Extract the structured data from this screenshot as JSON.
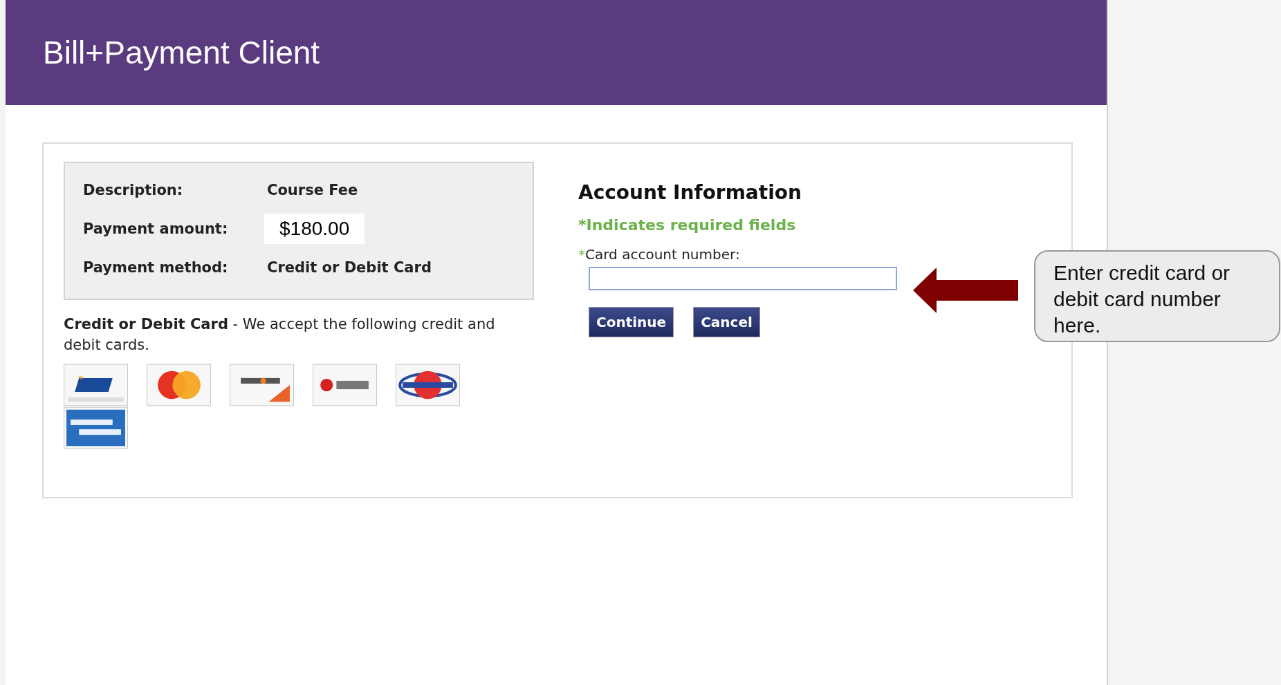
{
  "header": {
    "title": "Bill+Payment Client"
  },
  "summary": [
    {
      "label": "Description:",
      "value": "Course Fee",
      "kind": "plain"
    },
    {
      "label": "Payment amount:",
      "value": "$180.00",
      "kind": "amount"
    },
    {
      "label": "Payment method:",
      "value": "Credit or Debit Card",
      "kind": "plain"
    }
  ],
  "cards_note": {
    "text": "**Credit or Debit Card** - We accept the following credit and debit cards."
  },
  "accepted_cards": [
    {
      "kind": "visa"
    },
    {
      "kind": "mastercard"
    },
    {
      "kind": "discover"
    },
    {
      "kind": "bccard"
    },
    {
      "kind": "dinacard"
    },
    {
      "kind": "amex"
    }
  ],
  "account": {
    "heading": "Account Information",
    "required_note": "*Indicates required fields",
    "field_mark": "*",
    "field_label": "Card account number:",
    "buttons": [
      "Continue",
      "Cancel"
    ]
  },
  "callout": {
    "text": "Enter credit card or debit card number here."
  }
}
